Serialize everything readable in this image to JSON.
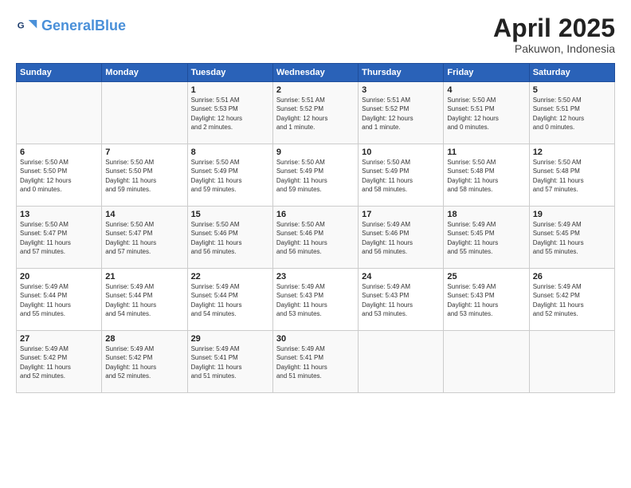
{
  "logo": {
    "text_general": "General",
    "text_blue": "Blue"
  },
  "title": {
    "month_year": "April 2025",
    "location": "Pakuwon, Indonesia"
  },
  "header_days": [
    "Sunday",
    "Monday",
    "Tuesday",
    "Wednesday",
    "Thursday",
    "Friday",
    "Saturday"
  ],
  "weeks": [
    [
      {
        "day": "",
        "info": ""
      },
      {
        "day": "",
        "info": ""
      },
      {
        "day": "1",
        "info": "Sunrise: 5:51 AM\nSunset: 5:53 PM\nDaylight: 12 hours\nand 2 minutes."
      },
      {
        "day": "2",
        "info": "Sunrise: 5:51 AM\nSunset: 5:52 PM\nDaylight: 12 hours\nand 1 minute."
      },
      {
        "day": "3",
        "info": "Sunrise: 5:51 AM\nSunset: 5:52 PM\nDaylight: 12 hours\nand 1 minute."
      },
      {
        "day": "4",
        "info": "Sunrise: 5:50 AM\nSunset: 5:51 PM\nDaylight: 12 hours\nand 0 minutes."
      },
      {
        "day": "5",
        "info": "Sunrise: 5:50 AM\nSunset: 5:51 PM\nDaylight: 12 hours\nand 0 minutes."
      }
    ],
    [
      {
        "day": "6",
        "info": "Sunrise: 5:50 AM\nSunset: 5:50 PM\nDaylight: 12 hours\nand 0 minutes."
      },
      {
        "day": "7",
        "info": "Sunrise: 5:50 AM\nSunset: 5:50 PM\nDaylight: 11 hours\nand 59 minutes."
      },
      {
        "day": "8",
        "info": "Sunrise: 5:50 AM\nSunset: 5:49 PM\nDaylight: 11 hours\nand 59 minutes."
      },
      {
        "day": "9",
        "info": "Sunrise: 5:50 AM\nSunset: 5:49 PM\nDaylight: 11 hours\nand 59 minutes."
      },
      {
        "day": "10",
        "info": "Sunrise: 5:50 AM\nSunset: 5:49 PM\nDaylight: 11 hours\nand 58 minutes."
      },
      {
        "day": "11",
        "info": "Sunrise: 5:50 AM\nSunset: 5:48 PM\nDaylight: 11 hours\nand 58 minutes."
      },
      {
        "day": "12",
        "info": "Sunrise: 5:50 AM\nSunset: 5:48 PM\nDaylight: 11 hours\nand 57 minutes."
      }
    ],
    [
      {
        "day": "13",
        "info": "Sunrise: 5:50 AM\nSunset: 5:47 PM\nDaylight: 11 hours\nand 57 minutes."
      },
      {
        "day": "14",
        "info": "Sunrise: 5:50 AM\nSunset: 5:47 PM\nDaylight: 11 hours\nand 57 minutes."
      },
      {
        "day": "15",
        "info": "Sunrise: 5:50 AM\nSunset: 5:46 PM\nDaylight: 11 hours\nand 56 minutes."
      },
      {
        "day": "16",
        "info": "Sunrise: 5:50 AM\nSunset: 5:46 PM\nDaylight: 11 hours\nand 56 minutes."
      },
      {
        "day": "17",
        "info": "Sunrise: 5:49 AM\nSunset: 5:46 PM\nDaylight: 11 hours\nand 56 minutes."
      },
      {
        "day": "18",
        "info": "Sunrise: 5:49 AM\nSunset: 5:45 PM\nDaylight: 11 hours\nand 55 minutes."
      },
      {
        "day": "19",
        "info": "Sunrise: 5:49 AM\nSunset: 5:45 PM\nDaylight: 11 hours\nand 55 minutes."
      }
    ],
    [
      {
        "day": "20",
        "info": "Sunrise: 5:49 AM\nSunset: 5:44 PM\nDaylight: 11 hours\nand 55 minutes."
      },
      {
        "day": "21",
        "info": "Sunrise: 5:49 AM\nSunset: 5:44 PM\nDaylight: 11 hours\nand 54 minutes."
      },
      {
        "day": "22",
        "info": "Sunrise: 5:49 AM\nSunset: 5:44 PM\nDaylight: 11 hours\nand 54 minutes."
      },
      {
        "day": "23",
        "info": "Sunrise: 5:49 AM\nSunset: 5:43 PM\nDaylight: 11 hours\nand 53 minutes."
      },
      {
        "day": "24",
        "info": "Sunrise: 5:49 AM\nSunset: 5:43 PM\nDaylight: 11 hours\nand 53 minutes."
      },
      {
        "day": "25",
        "info": "Sunrise: 5:49 AM\nSunset: 5:43 PM\nDaylight: 11 hours\nand 53 minutes."
      },
      {
        "day": "26",
        "info": "Sunrise: 5:49 AM\nSunset: 5:42 PM\nDaylight: 11 hours\nand 52 minutes."
      }
    ],
    [
      {
        "day": "27",
        "info": "Sunrise: 5:49 AM\nSunset: 5:42 PM\nDaylight: 11 hours\nand 52 minutes."
      },
      {
        "day": "28",
        "info": "Sunrise: 5:49 AM\nSunset: 5:42 PM\nDaylight: 11 hours\nand 52 minutes."
      },
      {
        "day": "29",
        "info": "Sunrise: 5:49 AM\nSunset: 5:41 PM\nDaylight: 11 hours\nand 51 minutes."
      },
      {
        "day": "30",
        "info": "Sunrise: 5:49 AM\nSunset: 5:41 PM\nDaylight: 11 hours\nand 51 minutes."
      },
      {
        "day": "",
        "info": ""
      },
      {
        "day": "",
        "info": ""
      },
      {
        "day": "",
        "info": ""
      }
    ]
  ]
}
